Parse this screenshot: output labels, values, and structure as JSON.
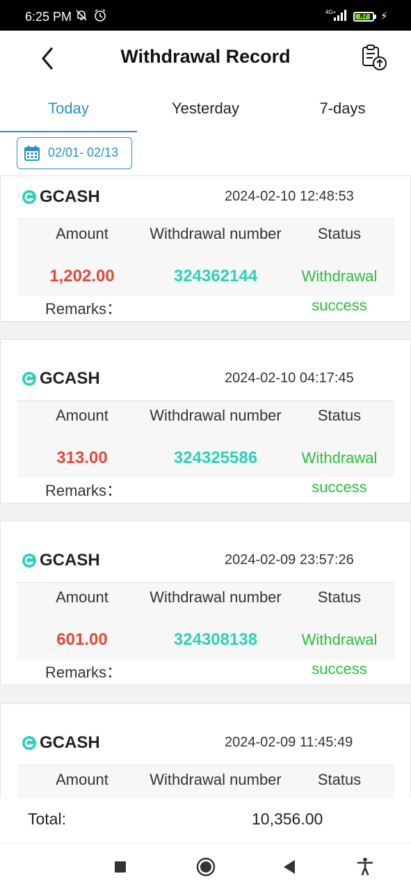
{
  "status_bar": {
    "time": "6:25 PM",
    "network": "4G+",
    "battery": "87",
    "battery_level_percent": 87,
    "icons": [
      "bell-off-icon",
      "alarm-icon",
      "signal-icon",
      "battery-icon",
      "charging-bolt-icon"
    ]
  },
  "header": {
    "title": "Withdrawal Record",
    "back_icon": "chevron-left-icon",
    "export_icon": "clipboard-upload-icon"
  },
  "tabs": [
    {
      "label": "Today",
      "active": true
    },
    {
      "label": "Yesterday",
      "active": false
    },
    {
      "label": "7-days",
      "active": false
    }
  ],
  "date_filter": {
    "label": "02/01- 02/13",
    "icon": "calendar-icon"
  },
  "columns": {
    "amount": "Amount",
    "number": "Withdrawal number",
    "status": "Status"
  },
  "remarks_label": "Remarks：",
  "records": [
    {
      "method": "GCASH",
      "datetime": "2024-02-10 12:48:53",
      "amount": "1,202.00",
      "number": "324362144",
      "status_line1": "Withdrawal",
      "status_line2": "success"
    },
    {
      "method": "GCASH",
      "datetime": "2024-02-10 04:17:45",
      "amount": "313.00",
      "number": "324325586",
      "status_line1": "Withdrawal",
      "status_line2": "success"
    },
    {
      "method": "GCASH",
      "datetime": "2024-02-09 23:57:26",
      "amount": "601.00",
      "number": "324308138",
      "status_line1": "Withdrawal",
      "status_line2": "success"
    },
    {
      "method": "GCASH",
      "datetime": "2024-02-09 11:45:49",
      "amount": "",
      "number": "",
      "status_line1": "",
      "status_line2": ""
    }
  ],
  "total": {
    "label": "Total:",
    "value": "10,356.00"
  },
  "colors": {
    "accent": "#2a8fc8",
    "amount": "#e2483d",
    "number": "#2dd0b8",
    "status": "#2cbd3b",
    "gcash": "#2dd0b8"
  },
  "nav_icons": [
    "recents-square-icon",
    "home-circle-icon",
    "back-triangle-icon",
    "accessibility-icon"
  ]
}
